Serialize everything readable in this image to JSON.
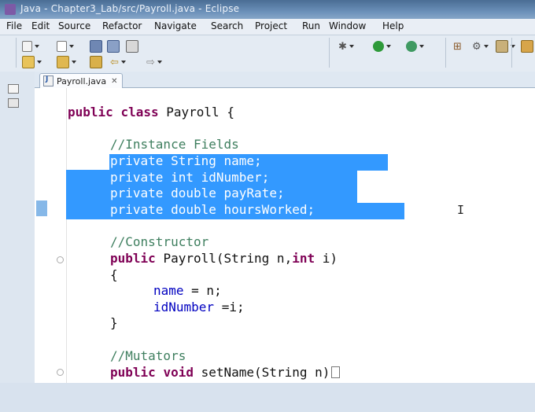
{
  "window": {
    "title": "Java - Chapter3_Lab/src/Payroll.java - Eclipse"
  },
  "menu": [
    "File",
    "Edit",
    "Source",
    "Refactor",
    "Navigate",
    "Search",
    "Project",
    "Run",
    "Window",
    "Help"
  ],
  "icons": {
    "app": "eclipse-icon",
    "toolbar": [
      "new-wizard-icon",
      "new-file-icon",
      "save-icon",
      "save-all-icon",
      "print-icon",
      "debug-icon",
      "run-icon",
      "external-tools-icon",
      "new-package-icon",
      "open-type-icon",
      "open-perspective-icon",
      "next-annotation-icon",
      "prev-annotation-icon",
      "last-edit-icon",
      "back-icon",
      "forward-icon"
    ]
  },
  "editor": {
    "tab": {
      "label": "Payroll.java"
    },
    "code": {
      "class_decl": [
        "public",
        "class",
        "Payroll {"
      ],
      "comment_fields": "//Instance Fields",
      "field1": [
        "private",
        "String",
        "name;"
      ],
      "field2": [
        "private",
        "int",
        "idNumber;"
      ],
      "field3": [
        "private",
        "double",
        "payRate;"
      ],
      "field4": [
        "private",
        "double",
        "hoursWorked;"
      ],
      "comment_ctor": "//Constructor",
      "ctor": [
        "public",
        "Payroll(String n,",
        "int",
        "i)"
      ],
      "brace_open": "{",
      "assign1": [
        "name",
        " = n;"
      ],
      "assign2": [
        "idNumber",
        " =i;"
      ],
      "brace_close": "}",
      "comment_mut": "//Mutators",
      "setter": [
        "public",
        "void",
        "setName(String n)"
      ]
    }
  }
}
